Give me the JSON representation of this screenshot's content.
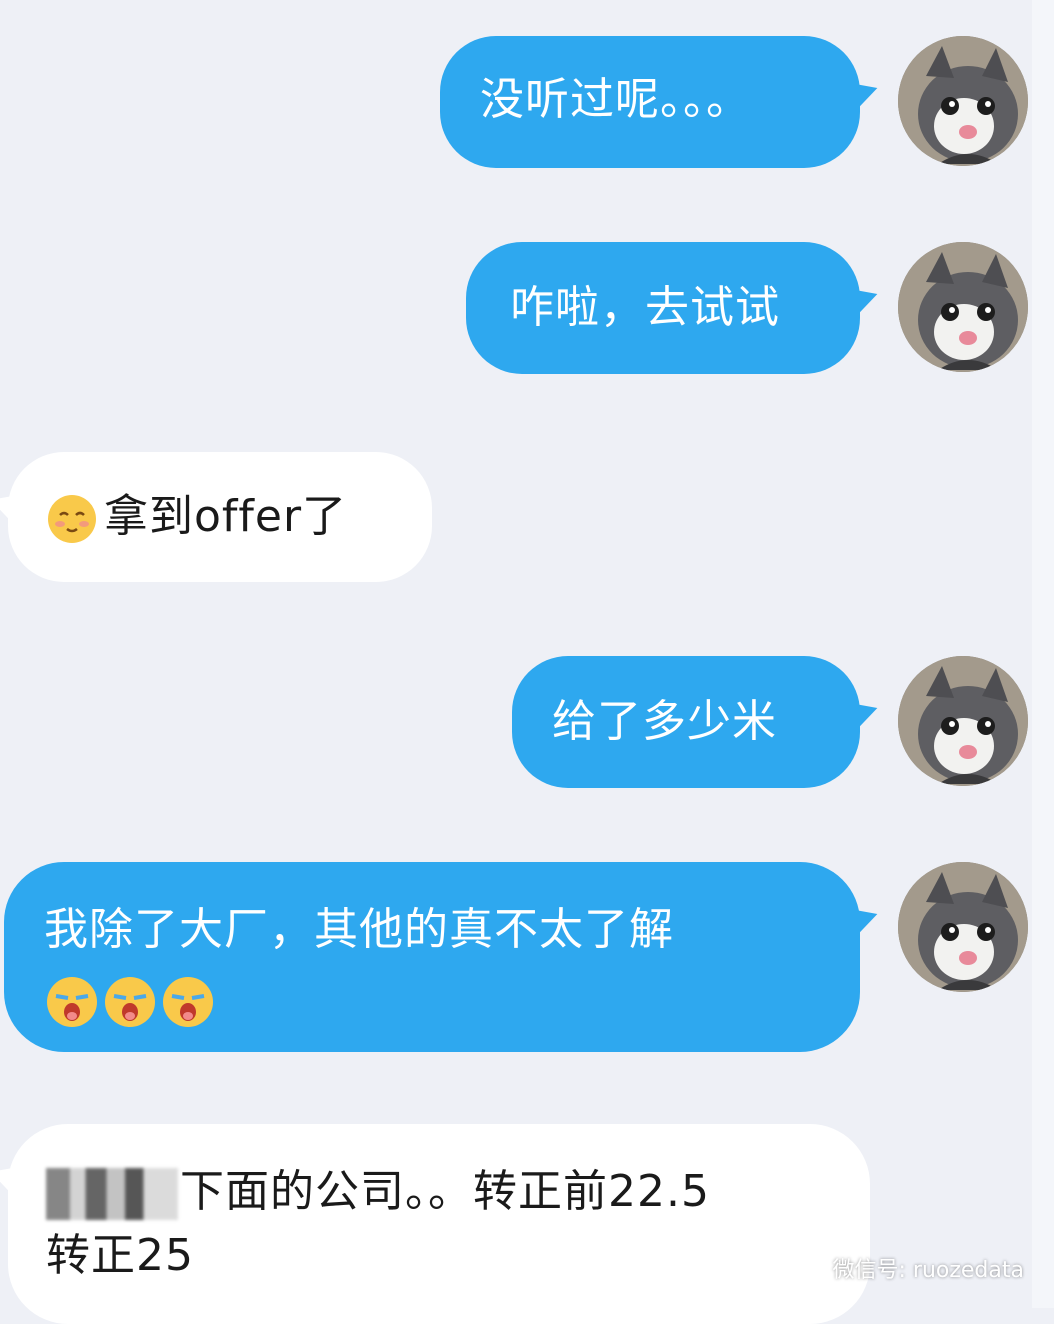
{
  "messages": [
    {
      "direction": "out",
      "text": "没听过呢。。。"
    },
    {
      "direction": "out",
      "text": "咋啦，去试试"
    },
    {
      "direction": "in",
      "emoji": "blushing-face-emoji",
      "text": "拿到offer了"
    },
    {
      "direction": "out",
      "text": "给了多少米"
    },
    {
      "direction": "out",
      "text": "我除了大厂，其他的真不太了解",
      "emoji": "crying-face-emoji",
      "emoji_count": 3
    },
    {
      "direction": "in",
      "redacted_prefix": true,
      "line1": "下面的公司。。转正前22.5",
      "line2": "转正25"
    }
  ],
  "watermark": {
    "text": "微信号: ruozedata",
    "icon": "wechat-icon"
  },
  "colors": {
    "outgoing_bubble": "#2ea8ef",
    "incoming_bubble": "#ffffff",
    "background": "#eef0f6"
  }
}
